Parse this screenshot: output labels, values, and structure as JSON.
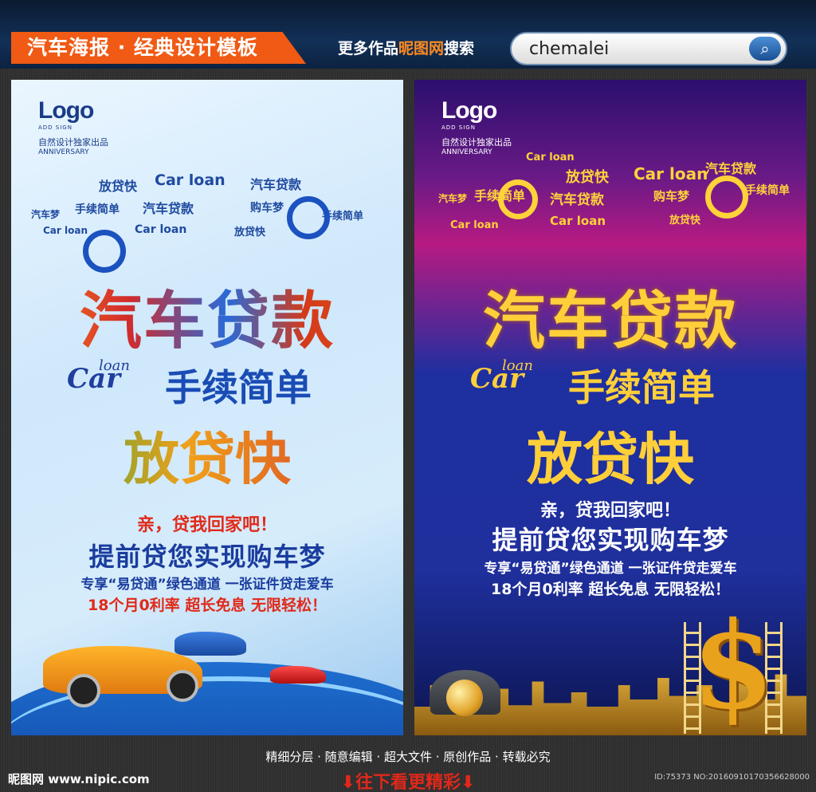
{
  "header": {
    "tag_label": "汽车海报 · 经典设计模板",
    "more_prefix": "更多作品",
    "more_highlight": "昵图网",
    "more_suffix": "搜索",
    "search_value": "chemalei",
    "search_icon": "magnifier-icon"
  },
  "posters": [
    {
      "logo": "Logo",
      "logo_small": "ADD SIGN",
      "logo_cn": "自然设计独家出品",
      "logo_en": "ANNIVERSARY",
      "headline": "汽车贷款",
      "car": "Car",
      "loan": "loan",
      "subhead": "手续简单",
      "headline2": "放贷快",
      "slogan": "亲，贷我回家吧！",
      "title": "提前贷您实现购车梦",
      "desc": "专享“易贷通”绿色通道 一张证件贷走爱车",
      "offer": "18个月0利率 超长免息 无限轻松！"
    },
    {
      "logo": "Logo",
      "logo_small": "ADD SIGN",
      "logo_cn": "自然设计独家出品",
      "logo_en": "ANNIVERSARY",
      "headline": "汽车贷款",
      "car": "Car",
      "loan": "loan",
      "subhead": "手续简单",
      "headline2": "放贷快",
      "slogan": "亲，贷我回家吧！",
      "title": "提前贷您实现购车梦",
      "desc": "专享“易贷通”绿色通道 一张证件贷走爱车",
      "offer": "18个月0利率 超长免息 无限轻松！"
    }
  ],
  "cloud_words": [
    "汽车梦",
    "放贷快",
    "手续简单",
    "汽车贷款",
    "Car loan",
    "购车梦",
    "放贷快"
  ],
  "footer": {
    "features": "精细分层 · 随意编辑 · 超大文件 · 原创作品 · 转载必究",
    "more": "⬇往下看更精彩⬇",
    "site": "昵图网 www.nipic.com",
    "id": "ID:75373 NO:20160910170356628000"
  },
  "colors": {
    "tag_bg": "#f05a14",
    "header_bg": "#123057",
    "poster1_accent": "#1a3c9e",
    "poster1_red": "#e02a1a",
    "poster2_gold": "#ffcf3a",
    "footer_red": "#e0281a"
  }
}
